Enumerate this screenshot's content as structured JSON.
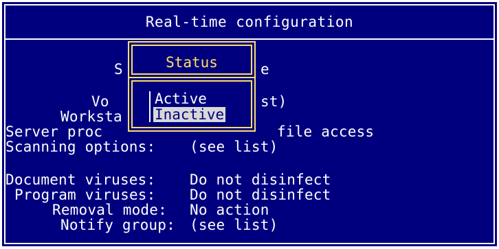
{
  "window": {
    "title": "Real-time configuration"
  },
  "form": {
    "status_row": {
      "label": "S",
      "value": "e"
    },
    "voice_row": {
      "label": "Vo",
      "value": "st)"
    },
    "workstation_row": {
      "label": "Worksta"
    },
    "server_row": {
      "label": "Server proc",
      "value": "file access"
    },
    "scanning_row": {
      "label": "Scanning options:",
      "value": "(see list)"
    },
    "document_row": {
      "label": "Document viruses:",
      "value": "Do not disinfect"
    },
    "program_row": {
      "label": "Program viruses:",
      "value": "Do not disinfect"
    },
    "removal_row": {
      "label": "Removal mode:",
      "value": "No action"
    },
    "notify_row": {
      "label": "Notify group:",
      "value": "(see list)"
    }
  },
  "status_popup": {
    "title": "Status",
    "options": [
      {
        "label": "Active",
        "selected": false
      },
      {
        "label": "Inactive",
        "selected": true
      }
    ]
  },
  "colors": {
    "background": "#00007f",
    "text": "#ffffff",
    "popup_border": "#ffe066",
    "selection": "#d8d8d8"
  }
}
